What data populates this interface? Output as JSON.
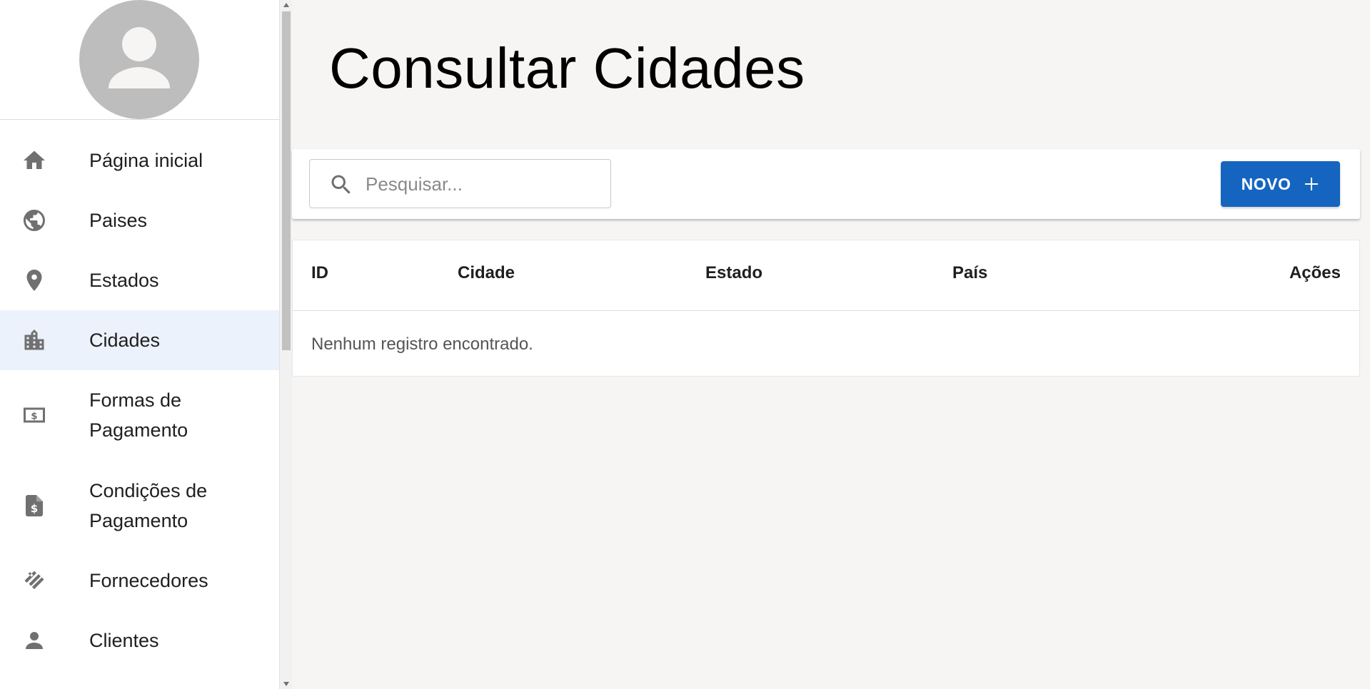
{
  "sidebar": {
    "items": [
      {
        "label": "Página inicial",
        "icon": "home-icon"
      },
      {
        "label": "Paises",
        "icon": "globe-icon"
      },
      {
        "label": "Estados",
        "icon": "location-pin-icon"
      },
      {
        "label": "Cidades",
        "icon": "city-icon",
        "active": true
      },
      {
        "label": "Formas de Pagamento",
        "icon": "cash-icon"
      },
      {
        "label": "Condições de Pagamento",
        "icon": "invoice-dollar-icon"
      },
      {
        "label": "Fornecedores",
        "icon": "handshake-icon"
      },
      {
        "label": "Clientes",
        "icon": "person-icon"
      }
    ]
  },
  "page": {
    "title": "Consultar Cidades"
  },
  "toolbar": {
    "search_placeholder": "Pesquisar...",
    "search_value": "",
    "new_label": "NOVO"
  },
  "table": {
    "columns": [
      "ID",
      "Cidade",
      "Estado",
      "País",
      "Ações"
    ],
    "empty_message": "Nenhum registro encontrado."
  },
  "colors": {
    "primary": "#1565c0",
    "active_item_bg": "#ebf2fb",
    "icon": "#707070"
  }
}
